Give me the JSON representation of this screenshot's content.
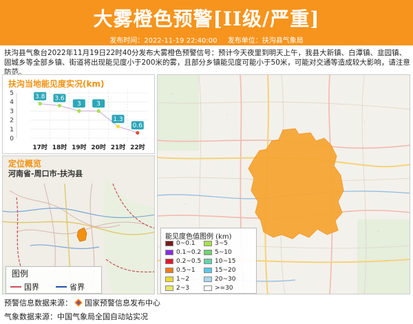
{
  "header": {
    "title": "大雾橙色预警[II级/严重]",
    "issue_time": "发布时间：2022-11-19 22:40:00",
    "issuer": "发布单位：扶沟县气象局"
  },
  "description": "扶沟县气象台2022年11月19日22时40分发布大雾橙色预警信号：预计今天夜里到明天上午，我县大新镇、白潭镇、韭园镇、固城乡等全部乡镇、街道将出现能见度小于200米的雾，且部分乡镇能见度可能小于50米，可能对交通等造成较大影响，请注意防范。",
  "visibility_panel": {
    "title": "扶沟当地能见度实况(km)"
  },
  "chart_data": {
    "type": "line",
    "title": "扶沟当地能见度实况(km)",
    "categories": [
      "17时",
      "18时",
      "19时",
      "20时",
      "21时",
      "22时"
    ],
    "values": [
      3.8,
      3.6,
      3,
      3,
      1.3,
      0.6
    ],
    "value_labels": [
      "3.8",
      "3.6",
      "3",
      "3",
      "1.3",
      "0.6"
    ],
    "y_ticks": [
      "0",
      "1",
      "2",
      "3",
      "4",
      "5"
    ],
    "ylim": [
      0,
      5
    ],
    "point_colors": [
      "#a8e04a",
      "#a8e04a",
      "#a8e04a",
      "#a8e04a",
      "#f2dc2a",
      "#e04a3a"
    ],
    "label_bg": "#2aa7b8"
  },
  "location_panel": {
    "title": "定位概览",
    "subtitle": "河南省-周口市-扶沟县",
    "legend_title": "图例",
    "legend_items": [
      {
        "label": "国界",
        "color": "#c8505a"
      },
      {
        "label": "省界",
        "color": "#1f4fa8"
      }
    ]
  },
  "color_legend": {
    "title": "能见度色值图例 (km)",
    "items": [
      {
        "label": "0~0.1",
        "color": "#7a1a1a"
      },
      {
        "label": "3~5",
        "color": "#a8e04a"
      },
      {
        "label": "0.1~0.2",
        "color": "#8a2be2"
      },
      {
        "label": "5~10",
        "color": "#6cd66c"
      },
      {
        "label": "0.2~0.5",
        "color": "#e0182a"
      },
      {
        "label": "10~15",
        "color": "#5fd6a8"
      },
      {
        "label": "0.5~1",
        "color": "#f07a1a"
      },
      {
        "label": "15~20",
        "color": "#5cc8e8"
      },
      {
        "label": "1~2",
        "color": "#f2dc2a"
      },
      {
        "label": "20~30",
        "color": "#a8d8f0"
      },
      {
        "label": "2~3",
        "color": "#e8e86a"
      },
      {
        "label": ">=30",
        "color": "#ffffff"
      }
    ]
  },
  "footer": {
    "source1_label": "预警信息数据来源：",
    "source1_value": "国家预警信息发布中心",
    "source2": "气象数据来源：中国气象局全国自动站实况"
  },
  "colors": {
    "header_bg": "#f7941d",
    "warning_area": "#f7a530"
  }
}
